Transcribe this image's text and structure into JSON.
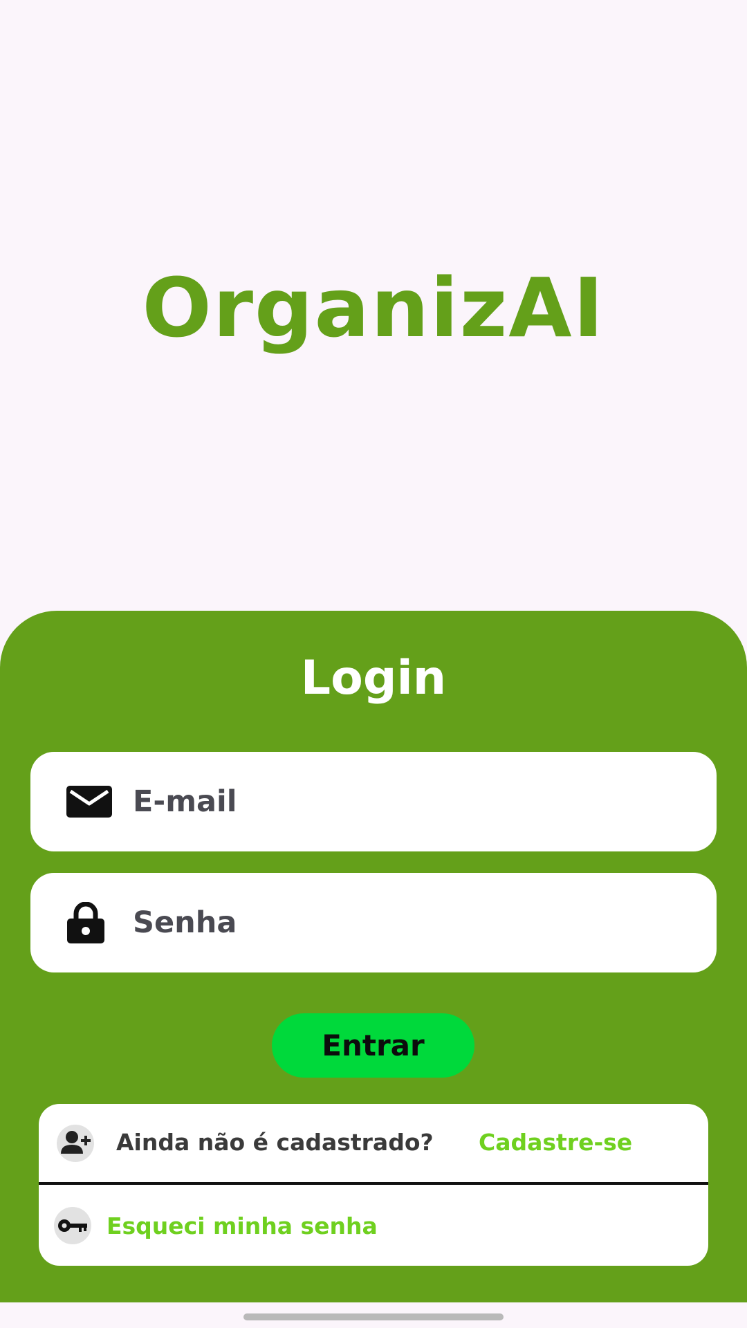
{
  "status_bar": {
    "time": "",
    "indicators": ""
  },
  "app": {
    "title": "OrganizAI"
  },
  "login": {
    "heading": "Login",
    "email": {
      "value": "",
      "placeholder": "E-mail",
      "icon": "mail-icon"
    },
    "password": {
      "value": "",
      "placeholder": "Senha",
      "icon": "lock-icon"
    },
    "submit_label": "Entrar"
  },
  "links": {
    "signup_question": "Ainda não é cadastrado?",
    "signup_link": "Cadastre-se",
    "signup_icon": "add-user-icon",
    "forgot_link": "Esqueci minha senha",
    "forgot_icon": "key-icon"
  },
  "colors": {
    "brand_green": "#64a01a",
    "button_green": "#00d93b",
    "link_green": "#6fd01f",
    "background": "#fbf5fb"
  }
}
